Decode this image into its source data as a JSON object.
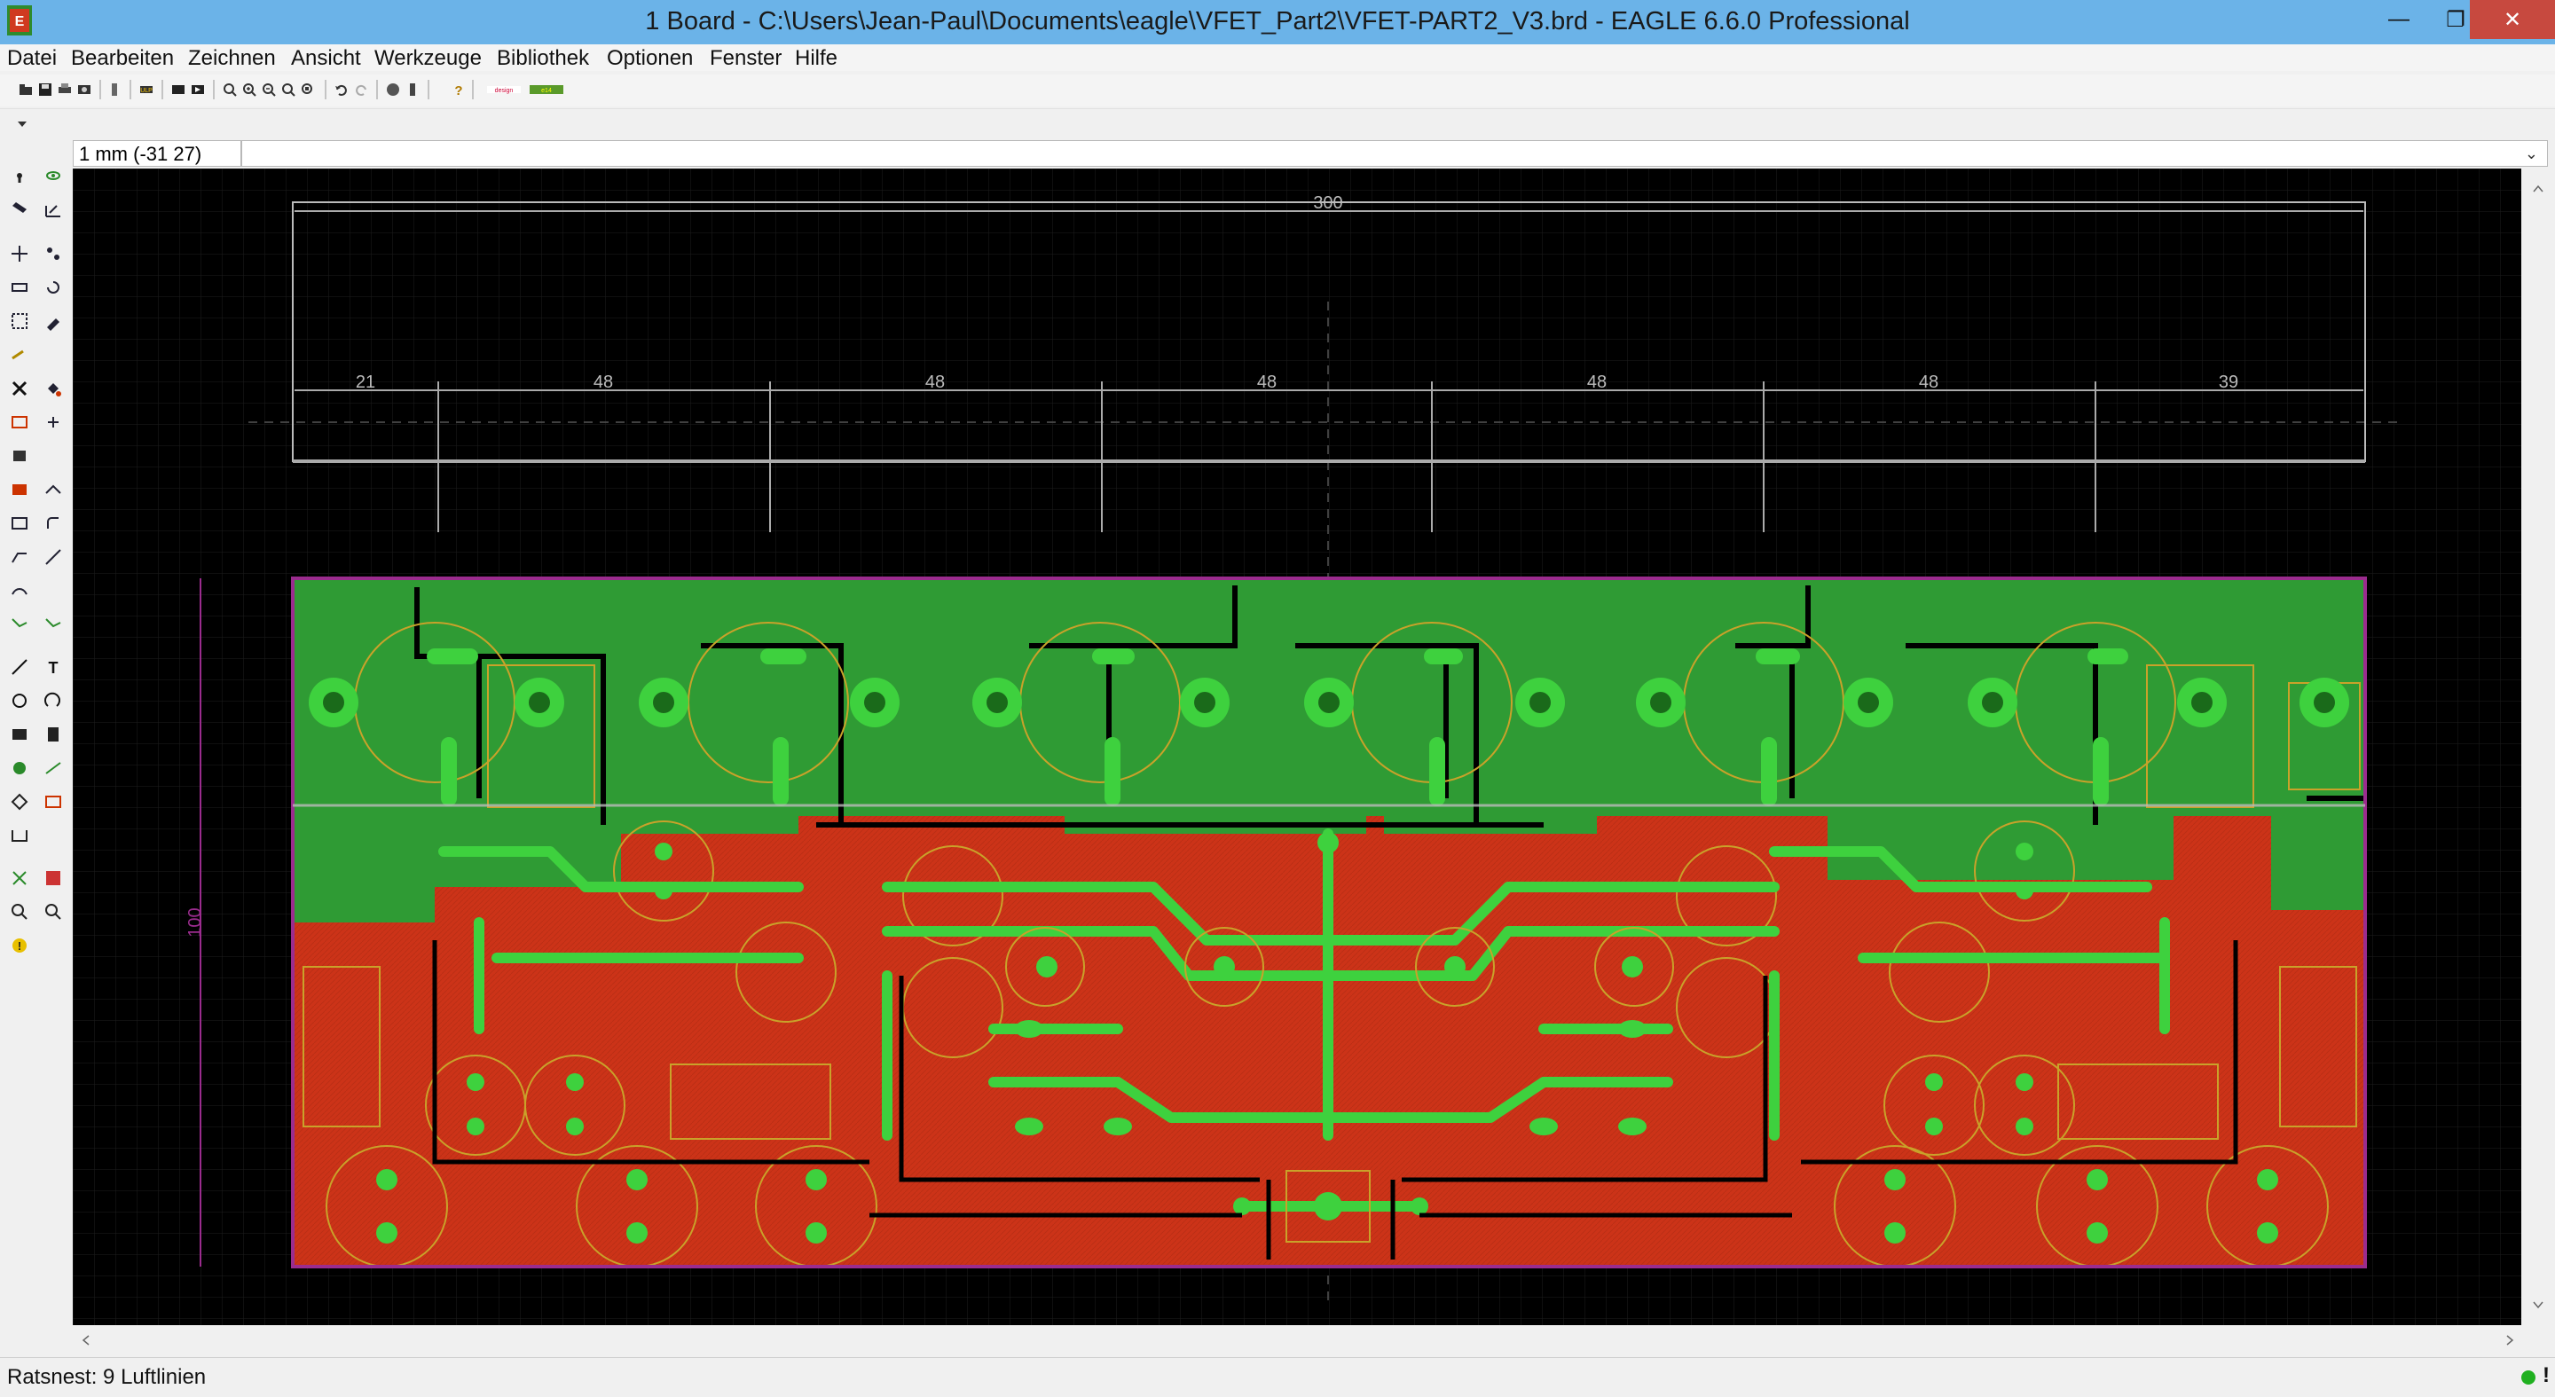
{
  "window": {
    "title": "1 Board - C:\\Users\\Jean-Paul\\Documents\\eagle\\VFET_Part2\\VFET-PART2_V3.brd - EAGLE 6.6.0 Professional",
    "minimize_icon": "minimize-icon",
    "maximize_icon": "restore-icon",
    "close_icon": "close-icon"
  },
  "menu": {
    "items": [
      "Datei",
      "Bearbeiten",
      "Zeichnen",
      "Ansicht",
      "Werkzeuge",
      "Bibliothek",
      "Optionen",
      "Fenster",
      "Hilfe"
    ]
  },
  "command": {
    "coordinate": "1 mm (-31 27)",
    "input_value": ""
  },
  "board": {
    "dimension_total": "300",
    "dimension_segments": [
      "21",
      "48",
      "48",
      "48",
      "48",
      "48",
      "39"
    ],
    "dimension_height": "100",
    "colors": {
      "top_copper": "#cc3318",
      "bottom_copper": "#2f9b34",
      "outline": "#9b2c8e",
      "silkscreen": "#c9a22a",
      "pads": "#3ed13e",
      "background": "#000000"
    }
  },
  "status": {
    "text": "Ratsnest: 9 Luftlinien"
  }
}
